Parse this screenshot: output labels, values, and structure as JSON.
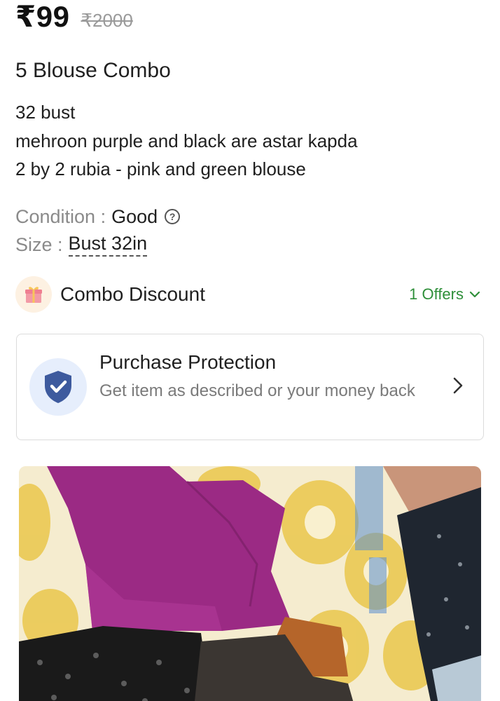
{
  "price": {
    "current": "₹99",
    "original": "₹2000"
  },
  "product": {
    "title": "5 Blouse Combo",
    "description": [
      "32 bust",
      "mehroon purple and black are astar kapda",
      "2 by 2 rubia - pink and green blouse"
    ]
  },
  "attributes": {
    "condition_label": "Condition :",
    "condition_value": "Good",
    "size_label": "Size :",
    "size_value": "Bust 32in"
  },
  "combo": {
    "label": "Combo Discount",
    "offers": "1 Offers",
    "icon": "gift-icon"
  },
  "protection": {
    "title": "Purchase Protection",
    "subtitle": "Get item as described or your money back",
    "icon": "shield-check-icon"
  },
  "colors": {
    "offers_green": "#2f8f3a",
    "shield_blue": "#3d5a9e",
    "muted_text": "#8a8a8a"
  }
}
